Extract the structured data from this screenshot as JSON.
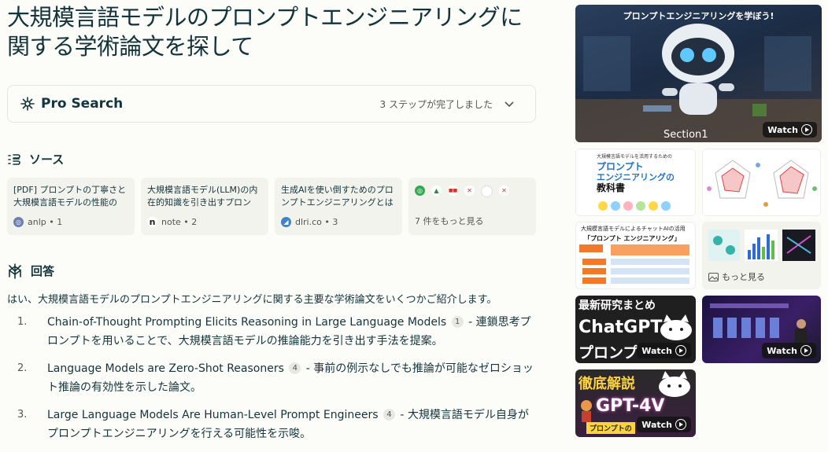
{
  "title": "大規模言語モデルのプロンプトエンジニアリングに関する学術論文を探して",
  "pro_search": {
    "label": "Pro Search",
    "steps": "3 ステップが完了しました"
  },
  "sources": {
    "heading": "ソース",
    "items": [
      {
        "title": "[PDF] プロンプトの丁寧さと大規模言語モデルの性能の関...",
        "site": "anlp",
        "num": "1"
      },
      {
        "title": "大規模言語モデル(LLM)の内在的知識を引き出すプロンプ...",
        "site": "note",
        "num": "2"
      },
      {
        "title": "生成AIを使い倒すためのプロンプトエンジニアリングとは 〜大...",
        "site": "dlri.co",
        "num": "3"
      }
    ],
    "more": "7 件をもっと見る"
  },
  "answer": {
    "heading": "回答",
    "intro": "はい、大規模言語モデルのプロンプトエンジニアリングに関する主要な学術論文をいくつかご紹介します。",
    "items": [
      {
        "num": "1.",
        "title": "Chain-of-Thought Prompting Elicits Reasoning in Large Language Models",
        "cite": "1",
        "desc": " - 連鎖思考プロンプトを用いることで、大規模言語モデルの推論能力を引き出す手法を提案。"
      },
      {
        "num": "2.",
        "title": "Language Models are Zero-Shot Reasoners",
        "cite": "4",
        "desc": " - 事前の例示なしでも推論が可能なゼロショット推論の有効性を示した論文。"
      },
      {
        "num": "3.",
        "title": "Large Language Models Are Human-Level Prompt Engineers",
        "cite": "4",
        "desc": " - 大規模言語モデル自身がプロンプトエンジニアリングを行える可能性を示唆。"
      }
    ]
  },
  "media": {
    "video1": {
      "caption": "プロンプトエンジニアリングを学ぼう!",
      "section": "Section1",
      "watch": "Watch"
    },
    "book": {
      "top": "大規模言語モデルを活用するための",
      "line1": "プロンプト",
      "line2": "エンジニアリングの",
      "line3": "教科書"
    },
    "slide": {
      "top": "大規模言語モデルによるチャットAIの活用",
      "title": "「プロンプト エンジニアリング」"
    },
    "more_images": "もっと見る",
    "video2": {
      "line1": "最新研究まとめ",
      "line2": "ChatGPT",
      "line3": "プロンプ",
      "watch": "Watch"
    },
    "video3": {
      "watch": "Watch"
    },
    "video4": {
      "line1": "徹底解説",
      "line2": "GPT-4V",
      "line3": "プロンプトの",
      "watch": "Watch"
    }
  }
}
